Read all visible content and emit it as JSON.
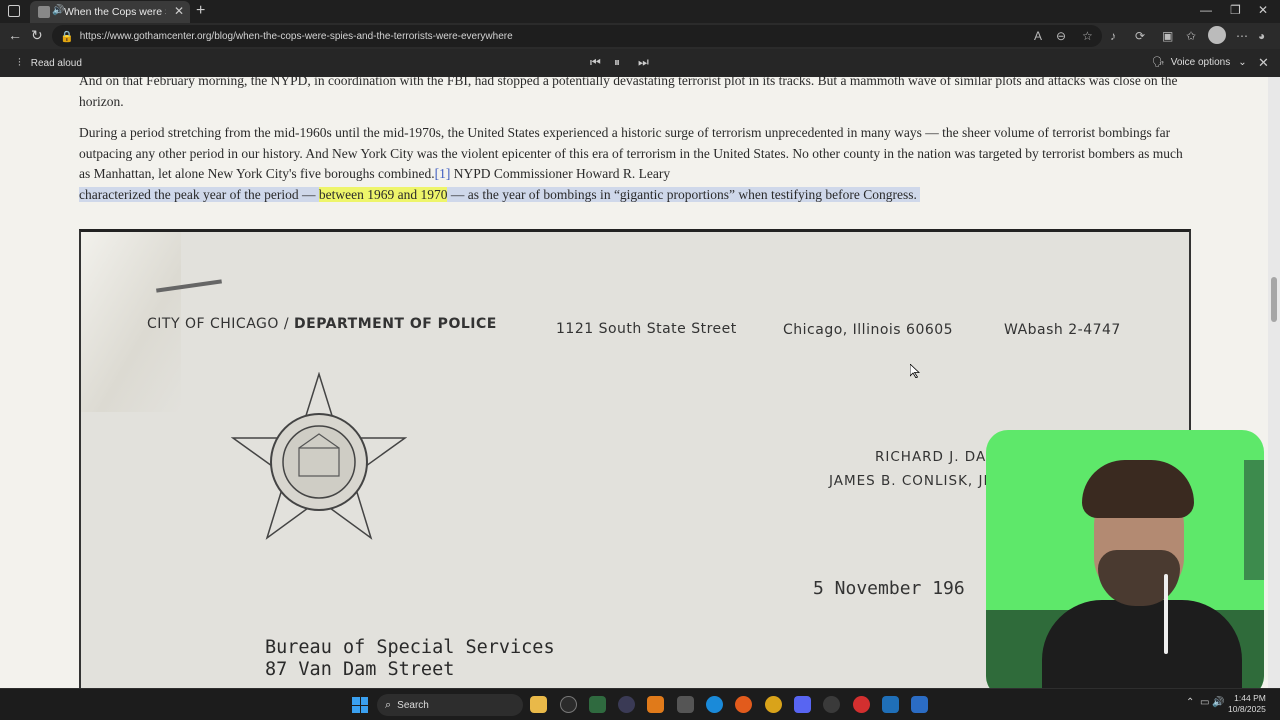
{
  "browser": {
    "tab_title": "When the Cops were Spies...",
    "url": "https://www.gothamcenter.org/blog/when-the-cops-were-spies-and-the-terrorists-were-everywhere"
  },
  "read_aloud": {
    "label": "Read aloud",
    "voice_options": "Voice options"
  },
  "article": {
    "p1": "And on that February morning, the NYPD, in coordination with the FBI, had stopped a potentially devastating terrorist plot in its tracks. But a mammoth wave of similar plots and attacks was close on the horizon.",
    "p2_a": "During a period stretching from the mid-1960s until the mid-1970s, the United States experienced a historic surge of terrorism unprecedented in many ways — the sheer volume of terrorist bombings far outpacing any other period in our history.  And New York City was the violent epicenter of this era of terrorism in the United States.  No other county in the nation was targeted by terrorist bombers as much as Manhattan, let alone New York City's five boroughs combined.",
    "p2_ref": "[1]",
    "p2_b": "  NYPD Commissioner Howard R. Leary",
    "p2_c": "characterized the peak year of the period — ",
    "p2_hl": "between 1969 and 1970",
    "p2_d": " — as the year of bombings in “gigantic proportions” when testifying before Congress."
  },
  "document": {
    "city": "CITY OF CHICAGO",
    "dept": "DEPARTMENT OF POLICE",
    "address": "1121 South State Street",
    "location": "Chicago, Illinois 60605",
    "phone": "WAbash 2-4747",
    "name1": "RICHARD J. DALE",
    "name2": "JAMES B. CONLISK, JR",
    "date": "5 November 196",
    "to_line1": "Bureau of Special Services",
    "to_line2": "87 Van Dam Street"
  },
  "taskbar": {
    "search_label": "Search",
    "time": "1:44 PM",
    "date": "10/8/2025"
  }
}
